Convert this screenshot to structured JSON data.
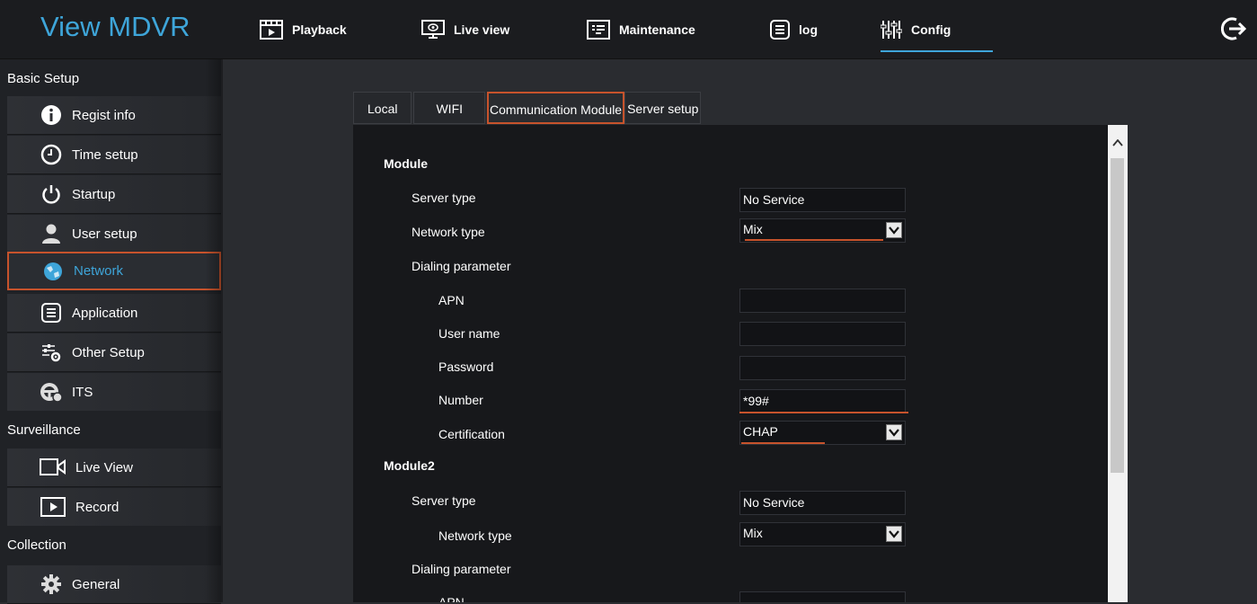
{
  "app": {
    "brand": "View MDVR"
  },
  "topnav": [
    {
      "label": "Playback",
      "icon": "playback-icon"
    },
    {
      "label": "Live view",
      "icon": "monitor-icon"
    },
    {
      "label": "Maintenance",
      "icon": "maintenance-icon"
    },
    {
      "label": "log",
      "icon": "log-icon"
    },
    {
      "label": "Config",
      "icon": "config-icon",
      "active": true
    }
  ],
  "sidebar": {
    "sections": [
      "Basic Setup",
      "Surveillance",
      "Collection"
    ],
    "items": [
      {
        "label": "Regist info",
        "icon": "info-icon"
      },
      {
        "label": "Time setup",
        "icon": "clock-icon"
      },
      {
        "label": "Startup",
        "icon": "power-icon"
      },
      {
        "label": "User setup",
        "icon": "user-icon"
      },
      {
        "label": "Network",
        "icon": "globe-icon",
        "active": true
      },
      {
        "label": "Application",
        "icon": "application-icon"
      },
      {
        "label": "Other Setup",
        "icon": "settings-sliders-icon"
      },
      {
        "label": "ITS",
        "icon": "steering-wheel-icon"
      },
      {
        "label": "Live View",
        "icon": "camera-icon"
      },
      {
        "label": "Record",
        "icon": "record-icon"
      },
      {
        "label": "General",
        "icon": "gear-icon"
      }
    ]
  },
  "tabs": [
    "Local",
    "WIFI",
    "Communication Module",
    "Server setup"
  ],
  "module1": {
    "title": "Module",
    "server_type_label": "Server type",
    "server_type_value": "No Service",
    "network_type_label": "Network type",
    "network_type_value": "Mix",
    "dialing_label": "Dialing parameter",
    "apn_label": "APN",
    "apn_value": "",
    "username_label": "User name",
    "username_value": "",
    "password_label": "Password",
    "password_value": "",
    "number_label": "Number",
    "number_value": "*99#",
    "cert_label": "Certification",
    "cert_value": "CHAP"
  },
  "module2": {
    "title": "Module2",
    "server_type_label": "Server type",
    "server_type_value": "No Service",
    "network_type_label": "Network type",
    "network_type_value": "Mix",
    "dialing_label": "Dialing parameter",
    "apn_label": "APN"
  },
  "colors": {
    "accent": "#3ea5d9",
    "highlight": "#c7532c",
    "panel": "#17181b"
  }
}
